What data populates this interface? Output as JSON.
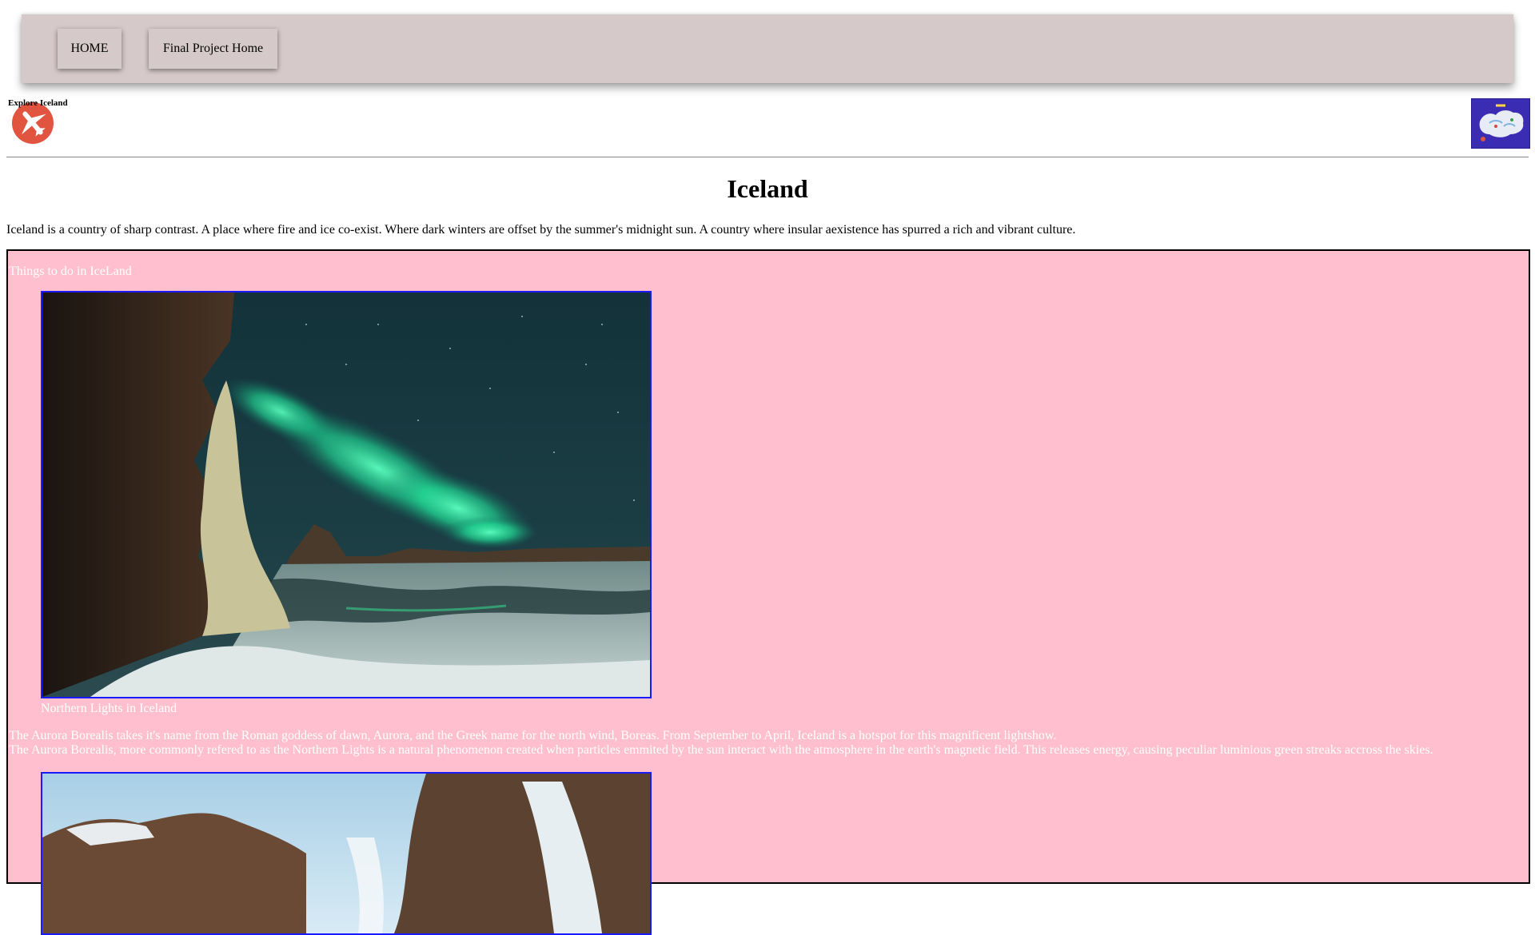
{
  "nav": {
    "home_label": "HOME",
    "project_label": "Final Project Home",
    "bg_color": "#d6c9c9"
  },
  "header": {
    "logo_caption": "Explore Iceland",
    "logo_icon": "airplane-icon",
    "map_icon": "iceland-map-icon"
  },
  "page": {
    "title": "Iceland",
    "intro": "Iceland is a country of sharp contrast. A place where fire and ice co-exist. Where dark winters are offset by the summer's midnight sun. A country where insular aexistence has spurred a rich and vibrant culture."
  },
  "section": {
    "heading": "Things to do in IceLand",
    "bg_color": "#ffbfce",
    "aurora_caption": "Northern Lights in Iceland",
    "aurora_desc_1": "The Aurora Borealis takes it's name from the Roman goddess of dawn, Aurora, and the Greek name for the north wind, Boreas. From September to April, Iceland is a hotspot for this magnificent lightshow.",
    "aurora_desc_2": "The Aurora Borealis, more commonly refered to as the Northern Lights is a natural phenomenon created when particles emmited by the sun interact with the atmosphere in the earth's magnetic field. This releases energy, causing peculiar luminious green streaks accross the skies."
  }
}
